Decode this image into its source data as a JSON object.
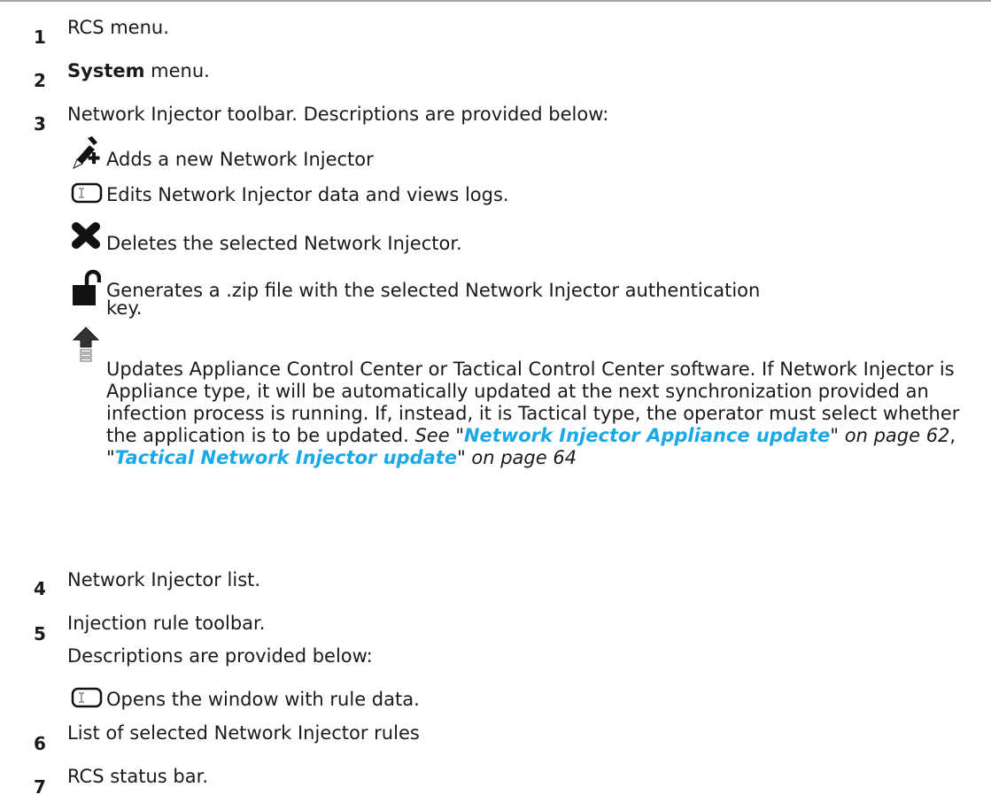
{
  "items": [
    {
      "num": "1",
      "text": "RCS menu."
    },
    {
      "num": "2",
      "bold": "System",
      "text": " menu."
    },
    {
      "num": "3",
      "text": "Network Injector toolbar. Descriptions are provided below:"
    },
    {
      "num": "4",
      "text": "Network Injector list."
    },
    {
      "num": "5",
      "text": "Injection rule toolbar.",
      "text2": "Descriptions are provided below:"
    },
    {
      "num": "6",
      "text": "List of selected Network Injector rules"
    },
    {
      "num": "7",
      "text": "RCS status bar."
    }
  ],
  "toolbar3": [
    {
      "icon": "add-pen-icon",
      "text": "Adds a new Network Injector"
    },
    {
      "icon": "edit-icon",
      "text": "Edits Network Injector data and views logs."
    },
    {
      "icon": "delete-x-icon",
      "text": "Deletes the selected Network Injector."
    },
    {
      "icon": "unlock-icon",
      "text1": "Generates a .zip file with the selected Network Injector authentication",
      "text2": "key."
    },
    {
      "icon": "update-arrow-icon",
      "text": "Updates Appliance Control Center or Tactical Control Center software. If Network Injector is Appliance type, it will be automatically updated at the next synchronization provided an infection process is running. If, instead, it is Tactical type, the operator must select whether the application is to be updated. ",
      "see": "See \"",
      "link1": "Network Injector Appliance update",
      "after1": "\" on page 62",
      "comma": ", ",
      "q": "\"",
      "link2": "Tactical Network Injector update",
      "after2": "\" on page 64"
    }
  ],
  "toolbar5": [
    {
      "icon": "edit-icon",
      "text": "Opens the window with rule data."
    }
  ],
  "colors": {
    "link": "#1ba9e6",
    "rule": "#a6a6a6"
  }
}
